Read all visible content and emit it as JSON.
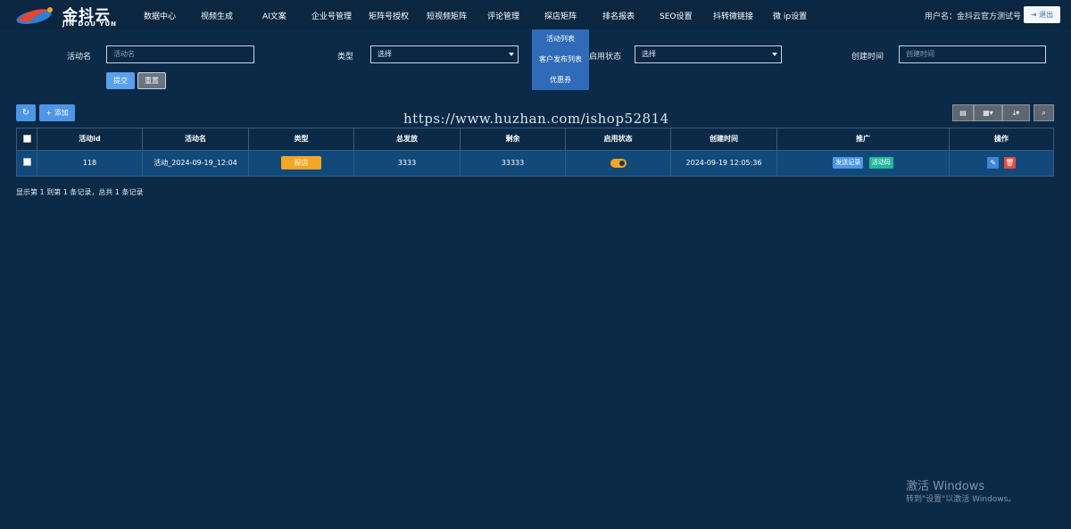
{
  "brand": {
    "name": "金抖云",
    "sub": "JIN DOU YUN"
  },
  "nav": [
    "数据中心",
    "视频生成",
    "AI文案",
    "企业号管理",
    "矩阵号授权",
    "短视频矩阵",
    "评论管理",
    "探店矩阵",
    "排名报表",
    "SEO设置",
    "抖转微链接",
    "微 ip设置"
  ],
  "user": {
    "label": "用户名：金抖云官方测试号",
    "logout": "退出"
  },
  "dropdown": [
    "活动列表",
    "客户发布列表",
    "优惠券"
  ],
  "filters": {
    "name_label": "活动名",
    "name_placeholder": "活动名",
    "type_label": "类型",
    "type_value": "选择",
    "status_label": "启用状态",
    "status_value": "选择",
    "created_label": "创建时间",
    "created_placeholder": "创建时间",
    "submit": "提交",
    "reset": "重置"
  },
  "toolbar": {
    "refresh_icon": "↻",
    "add": "+ 添加"
  },
  "watermark_url": "https://www.huzhan.com/ishop52814",
  "table": {
    "headers": [
      "活动id",
      "活动名",
      "类型",
      "总发放",
      "剩余",
      "启用状态",
      "创建时间",
      "推广",
      "操作"
    ],
    "rows": [
      {
        "id": "118",
        "name": "活动_2024-09-19_12:04",
        "type": "探店",
        "total": "3333",
        "remain": "33333",
        "created": "2024-09-19 12:05:36",
        "promo1": "发送记录",
        "promo2": "活动码"
      }
    ]
  },
  "pager_info": "显示第 1 到第 1 条记录，总共 1 条记录",
  "windows_watermark": {
    "title": "激活 Windows",
    "sub": "转到\"设置\"以激活 Windows。"
  }
}
